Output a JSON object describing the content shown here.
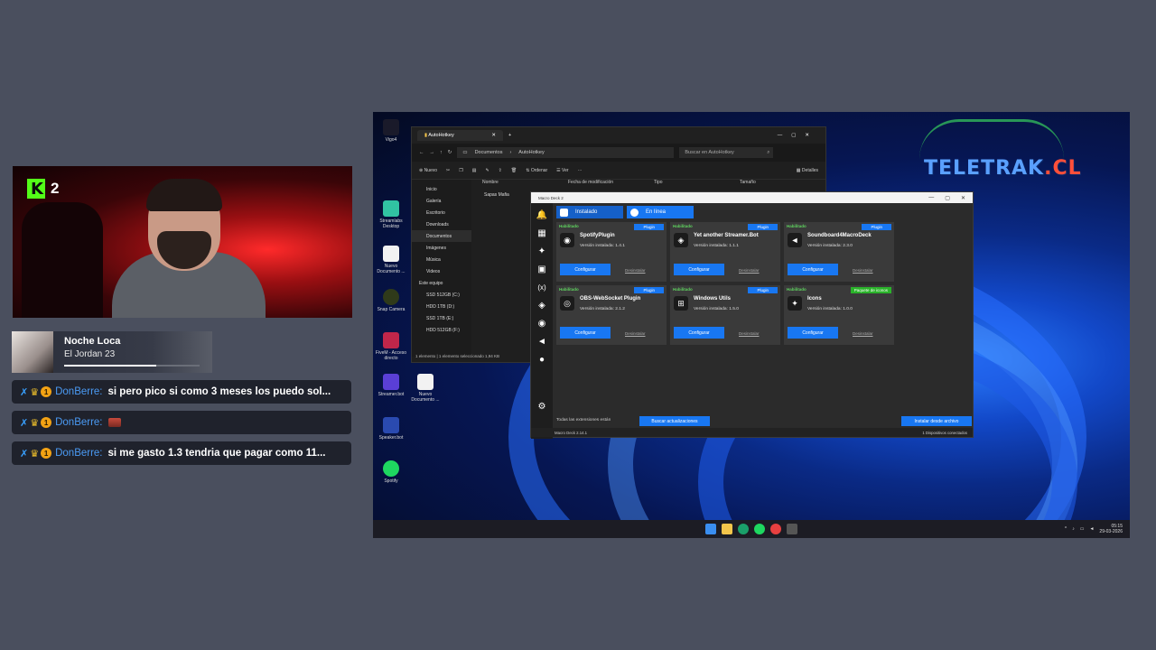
{
  "stream": {
    "viewer_count": "2"
  },
  "now_playing": {
    "song": "Noche Loca",
    "artist": "El Jordan 23",
    "progress": 0.68
  },
  "chat": [
    {
      "user": "DonBerre:",
      "message": "si pero pico si como 3 meses los puedo sol..."
    },
    {
      "user": "DonBerre:",
      "message": ""
    },
    {
      "user": "DonBerre:",
      "message": "si me gasto 1.3 tendria que pagar como 11..."
    }
  ],
  "desktop": {
    "logo_text": "TELETRAK",
    "logo_suffix": ".CL",
    "icons": [
      "Vigo4",
      "Streamlabs Desktop",
      "Nuevo Documento ...",
      "Snap Camera",
      "FiveM - Acceso directo",
      "Streamer.bot",
      "Nuevo Documento ...",
      "Speaker.bot",
      "Spotify"
    ]
  },
  "explorer": {
    "tab_title": "AutoHotkey",
    "path": [
      "Documentos",
      "AutoHotkey"
    ],
    "search_placeholder": "Buscar en AutoHotkey",
    "cmd": {
      "new": "Nuevo",
      "sort": "Ordenar",
      "view": "Ver",
      "details": "Detalles"
    },
    "sidebar": [
      "Inicio",
      "Galería",
      "Escritorio",
      "Downloads",
      "Documentos",
      "Imágenes",
      "Música",
      "Videos",
      "Este equipo",
      "SSD 512GB (C:)",
      "HDD 1TB (D:)",
      "SSD 1TB (E:)",
      "HDD 512GB (F:)"
    ],
    "columns": [
      "Nombre",
      "Fecha de modificación",
      "Tipo",
      "Tamaño"
    ],
    "file": "Sapas Mafia",
    "status": "1 elemento  |  1 elemento seleccionado  1,94 KB"
  },
  "macro_deck": {
    "title": "Macro Deck 2",
    "tabs": [
      "Instalado",
      "En línea"
    ],
    "cards": [
      {
        "status": "Habilitado",
        "tag": "Plugin",
        "name": "SpotifyPlugin",
        "version": "Versión instalada: 1.4.1",
        "logo": "spotify-icon"
      },
      {
        "status": "Habilitado",
        "tag": "Plugin",
        "name": "Yet another Streamer.Bot",
        "version": "Versión instalada: 1.1.1",
        "logo": "streamerbot-icon"
      },
      {
        "status": "Habilitado",
        "tag": "Plugin",
        "name": "Soundboard4MacroDeck",
        "version": "Versión instalada: 2.3.0",
        "logo": "speaker-icon"
      },
      {
        "status": "Habilitado",
        "tag": "Plugin",
        "name": "OBS-WebSocket Plugin",
        "version": "Versión instalada: 2.1.2",
        "logo": "obs-icon"
      },
      {
        "status": "Habilitado",
        "tag": "Plugin",
        "name": "Windows Utils",
        "version": "Versión instalada: 1.5.0",
        "logo": "windows-icon"
      },
      {
        "status": "Habilitado",
        "tag": "Paquete de iconos",
        "name": "Icons",
        "version": "Versión instalada: 1.0.0",
        "logo": "icons-pack-icon"
      }
    ],
    "configure_label": "Configurar",
    "uninstall_label": "Desinstalar",
    "footer_text": "Todas las extensiones están",
    "check_updates": "Buscar actualizaciones",
    "install_file": "Instalar desde archivo",
    "version_status": "Macro Deck 2.14.1",
    "devices_status": "1 Dispositivos conectados"
  },
  "taskbar": {
    "time": "05:15",
    "date": "29-03-2026"
  }
}
